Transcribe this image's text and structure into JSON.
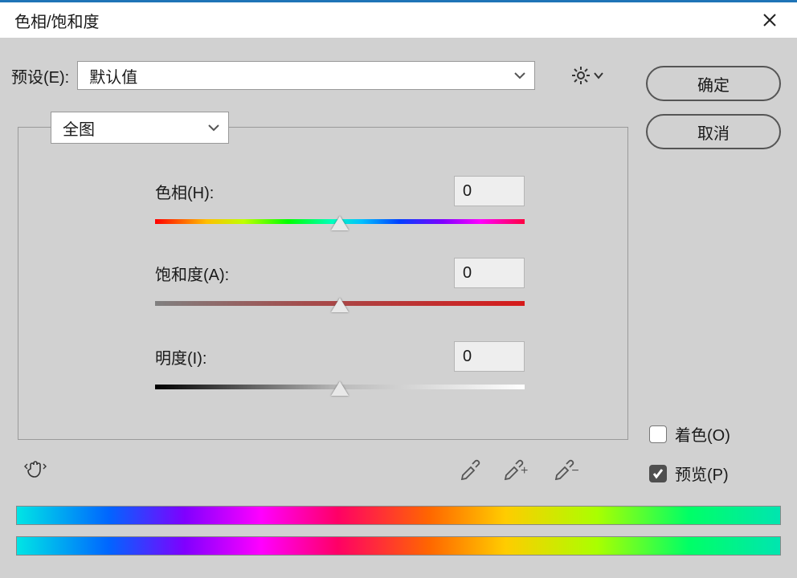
{
  "window": {
    "title": "色相/饱和度"
  },
  "preset": {
    "label": "预设(E):",
    "selected": "默认值"
  },
  "buttons": {
    "ok": "确定",
    "cancel": "取消"
  },
  "range": {
    "selected": "全图"
  },
  "sliders": {
    "hue": {
      "label": "色相(H):",
      "value": "0"
    },
    "saturation": {
      "label": "饱和度(A):",
      "value": "0"
    },
    "lightness": {
      "label": "明度(I):",
      "value": "0"
    }
  },
  "checks": {
    "colorize": {
      "label": "着色(O)",
      "checked": false
    },
    "preview": {
      "label": "预览(P)",
      "checked": true
    }
  },
  "icons": {
    "close": "close-icon",
    "gear": "gear-icon",
    "chevron": "chevron-down-icon",
    "hand": "hand-scrubby-icon",
    "eyedropper": "eyedropper-icon",
    "eyedropper_add": "eyedropper-add-icon",
    "eyedropper_sub": "eyedropper-subtract-icon"
  }
}
